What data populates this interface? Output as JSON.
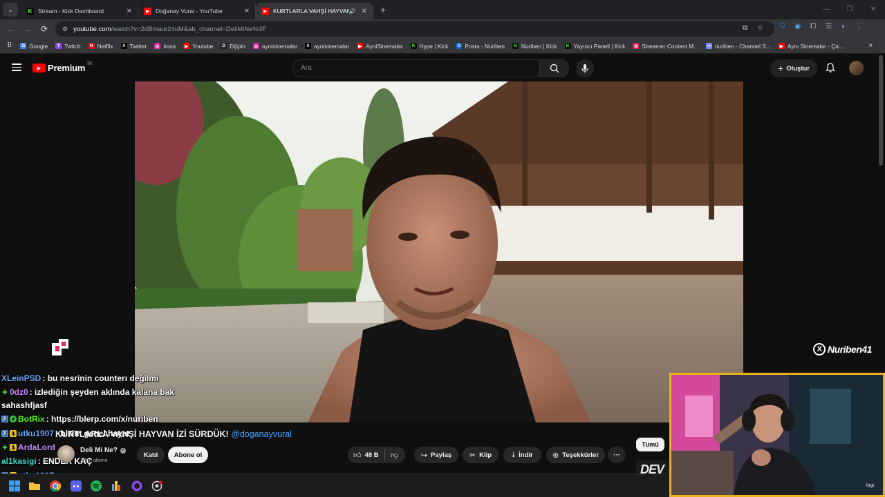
{
  "browser": {
    "tabs": [
      {
        "title": "Stream - Kick Dashboard",
        "favicon": "kick-icon",
        "color": "#53fc18"
      },
      {
        "title": "Doğanay Vural - YouTube",
        "favicon": "youtube-icon",
        "color": "#ff0000"
      },
      {
        "title": "KURTLARLA VAHŞİ HAYVAN",
        "favicon": "youtube-icon",
        "color": "#ff0000",
        "active": true
      }
    ],
    "url_host": "youtube.com",
    "url_rest": "/watch?v=2dBmaur24uM&ab_channel=DeliMiNe%3F",
    "bookmarks": [
      {
        "label": "Google",
        "icon": "google-icon",
        "color": "#4285f4"
      },
      {
        "label": "Twitch",
        "icon": "twitch-icon",
        "color": "#9146ff"
      },
      {
        "label": "Netflix",
        "icon": "netflix-icon",
        "color": "#e50914"
      },
      {
        "label": "Twitter",
        "icon": "x-icon",
        "color": "#000000"
      },
      {
        "label": "Insta",
        "icon": "instagram-icon",
        "color": "#d6249f"
      },
      {
        "label": "Youtube",
        "icon": "youtube-icon",
        "color": "#ff0000"
      },
      {
        "label": "Dijipin",
        "icon": "dijipin-icon",
        "color": "#222222"
      },
      {
        "label": "aynisinemalar",
        "icon": "instagram-icon",
        "color": "#d6249f"
      },
      {
        "label": "aynisinemalar",
        "icon": "x-icon",
        "color": "#000000"
      },
      {
        "label": "AyniSinemalar",
        "icon": "youtube-icon",
        "color": "#ff0000"
      },
      {
        "label": "Hype | Kick",
        "icon": "kick-icon",
        "color": "#53fc18"
      },
      {
        "label": "Posta - Nuriben",
        "icon": "outlook-icon",
        "color": "#0a64c8"
      },
      {
        "label": "Nuriben | Kick",
        "icon": "kick-icon",
        "color": "#53fc18"
      },
      {
        "label": "Yayıncı Paneli | Kick",
        "icon": "kick-icon",
        "color": "#53fc18"
      },
      {
        "label": "Streamer Content M...",
        "icon": "streamer-icon",
        "color": "#e0245e"
      },
      {
        "label": "nuriben - Channel S...",
        "icon": "channel-icon",
        "color": "#7a8cff"
      },
      {
        "label": "Aynı Sinemalar - Ça...",
        "icon": "youtube-icon",
        "color": "#ff0000"
      }
    ]
  },
  "youtube": {
    "logo_text": "Premium",
    "region": "TR",
    "search_placeholder": "Ara",
    "create_label": "Oluştur",
    "video_title_text": "KURTLARLA VAHŞİ HAYVAN İZİ SÜRDÜK!",
    "video_title_mention": "@doganayvural",
    "channel_name": "Deli Mi Ne?",
    "channel_subs": "2 Mn abone",
    "join_label": "Katıl",
    "subscribe_label": "Abone ol",
    "like_count": "48 B",
    "share_label": "Paylaş",
    "clip_label": "Klip",
    "download_label": "İndir",
    "thanks_label": "Teşekkürler",
    "more_label": "···",
    "chip_all": "Tümü",
    "next_thumb_text": "DEV"
  },
  "overlay": {
    "watermark": "Nuriben41",
    "webcam_label": "logi",
    "chat": [
      {
        "user": "XLeinPSD",
        "user_color": "#6aa8ff",
        "badges": [],
        "message": ": bu nesrinin counterı değilmi"
      },
      {
        "user": "0dz0",
        "user_color": "#c58af9",
        "badges": [
          "star"
        ],
        "message": ": izlediğin şeyden aklında kalana bak"
      },
      {
        "user": "",
        "user_color": "#ffffff",
        "badges": [],
        "message": "sahashfjasf"
      },
      {
        "user": "BotRix",
        "user_color": "#53fc18",
        "badges": [
          "blue",
          "green"
        ],
        "message": ": https://blerp.com/x/nuriben"
      },
      {
        "user": "utku1907",
        "user_color": "#6aa8ff",
        "badges": [
          "blue",
          "gold"
        ],
        "message": ": bizim genel hayat"
      },
      {
        "user": "ArdaLord",
        "user_color": "#c58af9",
        "badges": [
          "star",
          "gold"
        ],
        "message": ""
      },
      {
        "user": "al1kasigi",
        "user_color": "#3cd8c8",
        "badges": [],
        "message": ": ENDER KAÇ"
      },
      {
        "user": "utku1907",
        "user_color": "#6aa8ff",
        "badges": [
          "blue",
          "gold"
        ],
        "message": ":"
      }
    ]
  },
  "colors": {
    "kick_green": "#53fc18",
    "youtube_red": "#ff0000",
    "webcam_border": "#e7b21b",
    "link_blue": "#3ea6ff"
  }
}
